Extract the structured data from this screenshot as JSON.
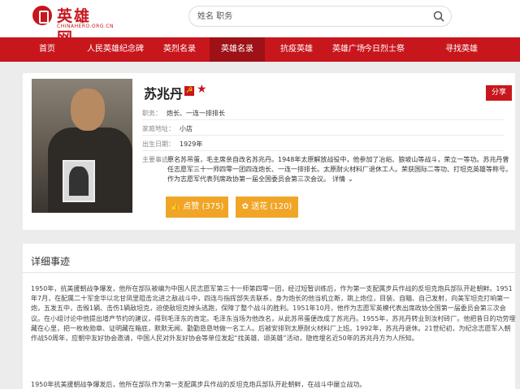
{
  "logo": {
    "text": "英雄网",
    "sub": "CHINAHERO.ORG.CN"
  },
  "search": {
    "placeholder": "姓名 职务"
  },
  "nav": [
    {
      "label": "首页"
    },
    {
      "label": "人民英雄纪念碑"
    },
    {
      "label": "英烈名录"
    },
    {
      "label": "英雄名录"
    },
    {
      "label": "抗疫英雄"
    },
    {
      "label": "英雄广场"
    },
    {
      "label": "今日烈士祭"
    },
    {
      "label": "寻找英雄"
    }
  ],
  "profile": {
    "name": "苏兆丹",
    "share": "分享",
    "job_label": "职务：",
    "job": "炮长、一连一排排长",
    "home_label": "家庭地址：",
    "home": "小店",
    "birth_label": "出生日期：",
    "birth": "1929年",
    "deeds_label": "主要事迹：",
    "deeds": "原名苏吊蛋，毛主席亲自改名苏兆丹。1948年太原解放战役中，他参加了冶峪、狼坡山等战斗，荣立一等功。苏兆丹曾任志愿军三十一师四零一团四连炮长、一连一排排长。太原耐火材料厂退休工人。荣获国际二等功、打坦克英雄等称号。作为志愿军代表列席政协第一届全国委员会第三次会议。",
    "more": "详情",
    "like_label": "点赞",
    "like_count": "(375)",
    "flower_label": "送花",
    "flower_count": "(120)"
  },
  "detail": {
    "title": "详细事迹",
    "paragraph": "1950年，抗美援朝战争爆发，他所在部队被编为中国人民志愿军第三十一师第四零一团，经过短暂训练后，作为第一支配属步兵作战的反坦克炮兵部队开赴朝鲜。1951年7月，在配属二十军金华以北甘凤里阻击北进之敌战斗中，四连与指挥部失去联系，身为炮长的他当机立断，跳上炮位，目装、自瞄、自己发射，向美军坦克打响第一炮，五发五中，击毁1辆、击伤1辆敌坦克，迫使敌坦克掉头逃跑，保障了整个战斗的胜利。1951年10月，他作为志愿军英模代表出席政协全国第一届委员会第三次会议。在小组讨论中他提出增产节约的建议，得到毛泽东的肯定。毛泽东当场为他改名，从此苏吊蛋便改成了苏兆丹。1955年，苏兆丹转业到汝村砖厂。他把昔日的功劳埋藏在心里，把一枚枚勋章、证明藏在箱底，默默无闻、勤勤恳恳地做一名工人。后被安排到太原耐火材料厂上班。1992年，苏兆丹退休。21世纪初，为纪念志愿军入朝作战50周年，应朝中友好协会邀请，中国人民对外友好协会等单位发起“找英雄、颂英雄”活动，隐姓埋名近50年的苏兆丹方为人所知。",
    "paragraph2": "1950年抗美援朝战争爆发后，他所在部队作为第一支配属步兵作战的反坦克炮兵部队开赴朝鲜，在战斗中屡立战功。"
  }
}
